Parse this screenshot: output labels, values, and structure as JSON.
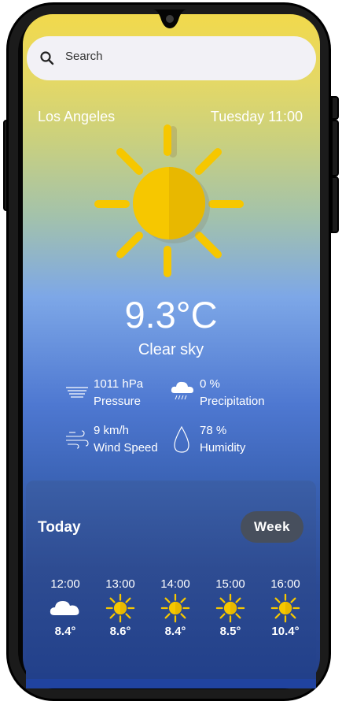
{
  "search": {
    "placeholder": "Search",
    "icon": "search-icon"
  },
  "header": {
    "city": "Los Angeles",
    "datetime": "Tuesday 11:00"
  },
  "current": {
    "icon": "sun-icon",
    "temperature": "9.3°C",
    "condition": "Clear sky"
  },
  "stats": {
    "pressure": {
      "value": "1011 hPa",
      "label": "Pressure",
      "icon": "pressure-icon"
    },
    "precipitation": {
      "value": "0 %",
      "label": "Precipitation",
      "icon": "rain-cloud-icon"
    },
    "wind": {
      "value": "9 km/h",
      "label": "Wind Speed",
      "icon": "wind-icon"
    },
    "humidity": {
      "value": "78 %",
      "label": "Humidity",
      "icon": "droplet-icon"
    }
  },
  "forecast": {
    "title": "Today",
    "toggle_label": "Week",
    "hours": [
      {
        "time": "12:00",
        "icon": "cloud-icon",
        "temp": "8.4°"
      },
      {
        "time": "13:00",
        "icon": "sun-icon",
        "temp": "8.6°"
      },
      {
        "time": "14:00",
        "icon": "sun-icon",
        "temp": "8.4°"
      },
      {
        "time": "15:00",
        "icon": "sun-icon",
        "temp": "8.5°"
      },
      {
        "time": "16:00",
        "icon": "sun-icon",
        "temp": "10.4°"
      }
    ]
  },
  "colors": {
    "sun": "#f6c700",
    "sun_shade": "#e8b800",
    "panel": "#2e4c92",
    "button": "#474f5d"
  }
}
